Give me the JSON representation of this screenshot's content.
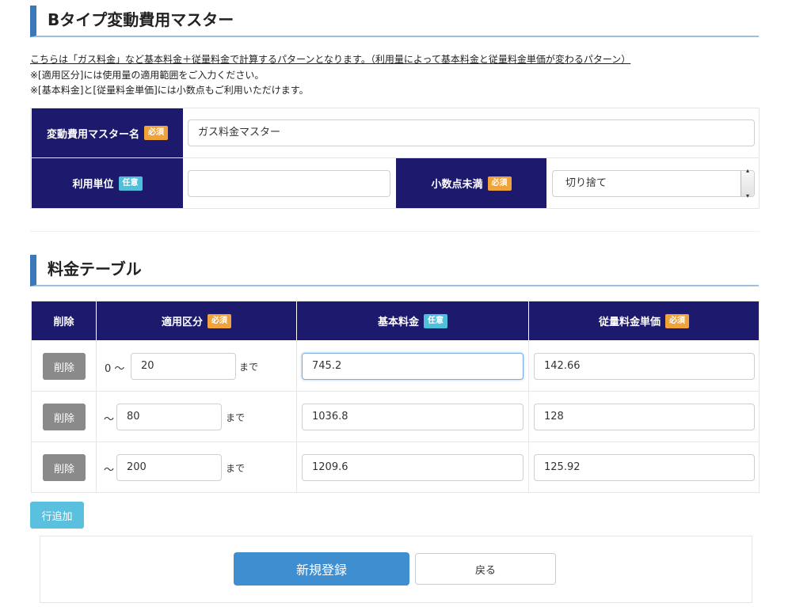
{
  "header": {
    "title": "Bタイプ変動費用マスター"
  },
  "description": {
    "line1": "こちらは「ガス料金」など基本料金＋従量料金で計算するパターンとなります。（利用量によって基本料金と従量料金単価が変わるパターン）",
    "line2": "※[適用区分]には使用量の適用範囲をご入力ください。",
    "line3": "※[基本料金]と[従量料金単価]には小数点もご利用いただけます。"
  },
  "form": {
    "master_name_label": "変動費用マスター名",
    "master_name_value": "ガス料金マスター",
    "unit_label": "利用単位",
    "unit_value": "",
    "decimal_label": "小数点未満",
    "decimal_value": "切り捨て",
    "required_badge": "必須",
    "optional_badge": "任意"
  },
  "table_section": {
    "title": "料金テーブル"
  },
  "table": {
    "headers": {
      "delete": "削除",
      "range": "適用区分",
      "base": "基本料金",
      "unit_price": "従量料金単価"
    },
    "rows": [
      {
        "delete_label": "削除",
        "prefix": "0 〜",
        "upper": "20",
        "suffix": "まで",
        "base": "745.2",
        "unit_price": "142.66"
      },
      {
        "delete_label": "削除",
        "prefix": "〜",
        "upper": "80",
        "suffix": "まで",
        "base": "1036.8",
        "unit_price": "128"
      },
      {
        "delete_label": "削除",
        "prefix": "〜",
        "upper": "200",
        "suffix": "まで",
        "base": "1209.6",
        "unit_price": "125.92"
      }
    ]
  },
  "buttons": {
    "add_row": "行追加",
    "submit": "新規登録",
    "back": "戻る"
  },
  "colors": {
    "header_bg": "#1d1a6e",
    "accent": "#3a78b9",
    "required": "#f0a33a",
    "optional": "#4fc0dc",
    "primary": "#3e8ed0",
    "info": "#5bc0de"
  }
}
